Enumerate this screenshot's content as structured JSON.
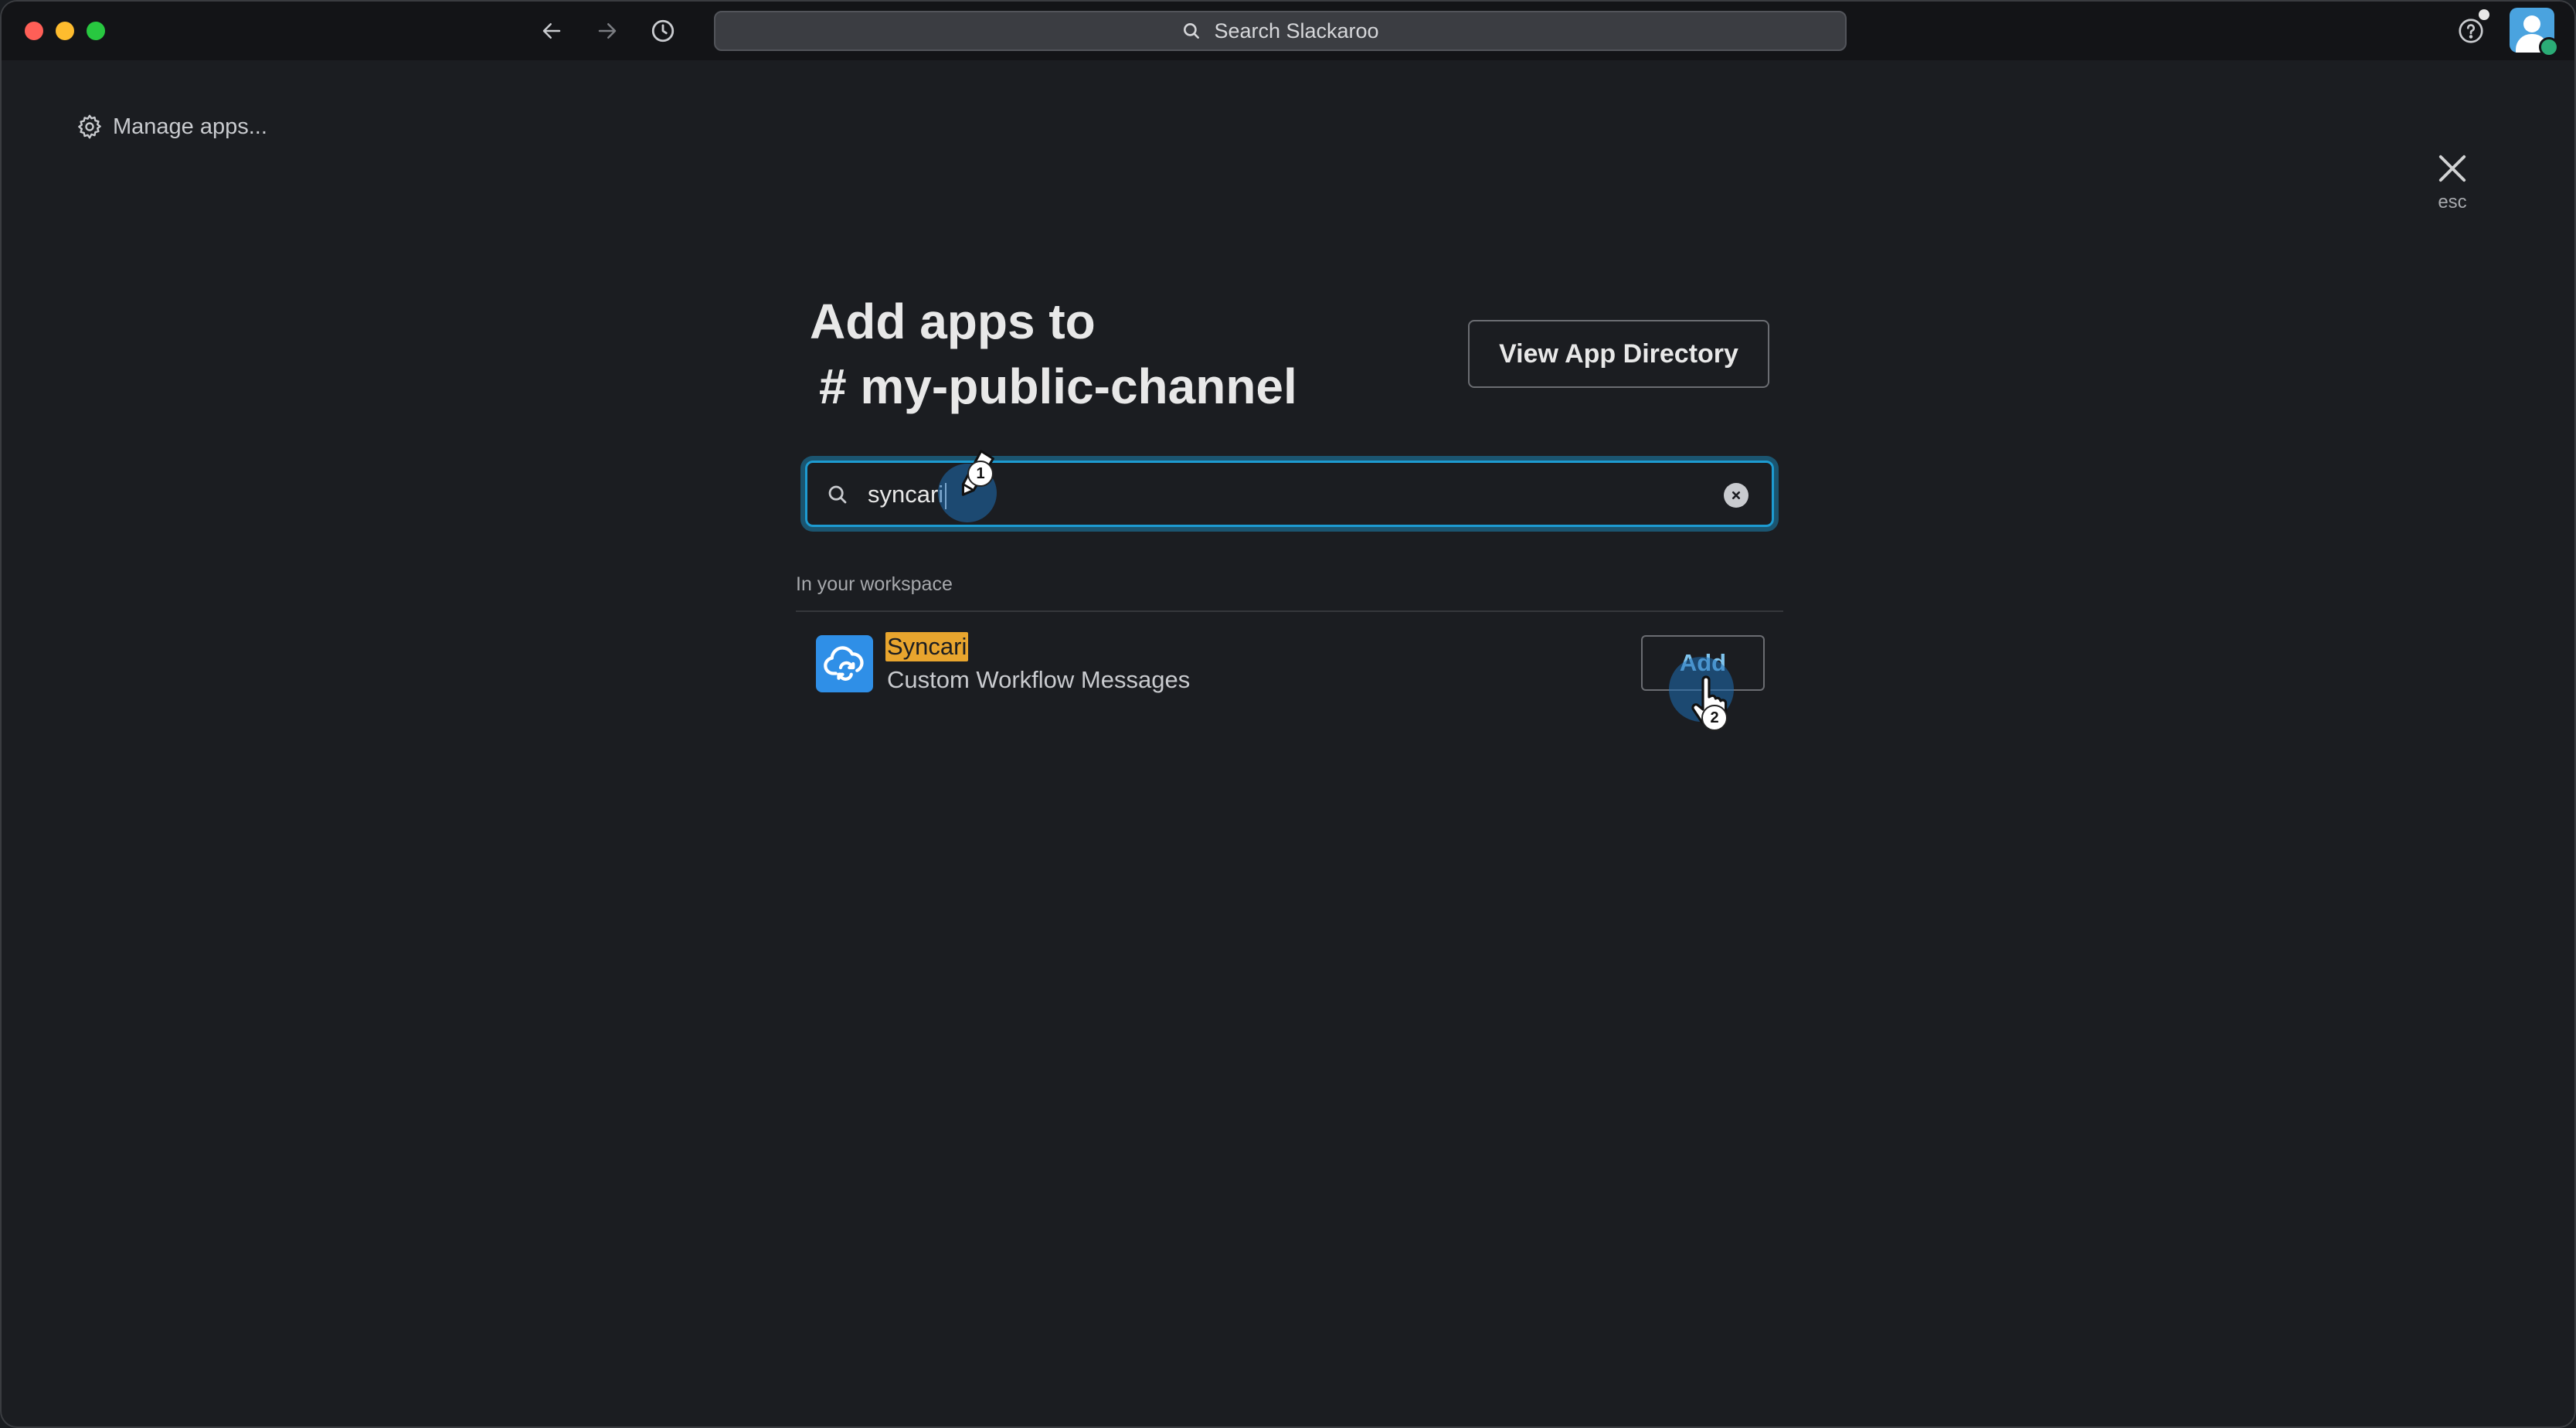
{
  "titlebar": {
    "search_placeholder": "Search Slackaroo",
    "icons": [
      "back-arrow-icon",
      "forward-arrow-icon",
      "history-icon",
      "help-icon"
    ]
  },
  "header": {
    "manage_apps_label": "Manage apps...",
    "close_hint": "esc"
  },
  "main": {
    "title_line1": "Add apps to",
    "title_line2": "# my-public-channel",
    "view_directory_label": "View App Directory",
    "search_value": "syncari",
    "section_label": "In your workspace",
    "apps": [
      {
        "name": "Syncari",
        "description": "Custom Workflow Messages",
        "action_label": "Add"
      }
    ]
  },
  "overlay": {
    "step1": "1",
    "step2": "2"
  },
  "colors": {
    "accent": "#1d9bd1",
    "highlight": "#e8a52e",
    "app_icon": "#2f8fe7",
    "background": "#1b1d21"
  }
}
